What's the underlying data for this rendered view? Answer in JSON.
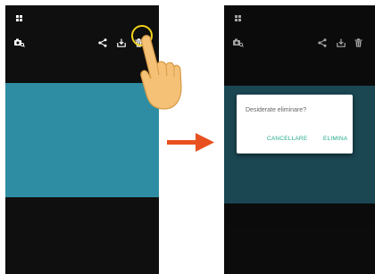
{
  "icons": {
    "grid": "grid-icon",
    "camera": "camera-search-icon",
    "share": "share-icon",
    "download": "download-icon",
    "delete": "trash-icon",
    "hand": "pointing-hand-icon",
    "arrow": "arrow-right-icon"
  },
  "colors": {
    "screen_bg": "#0f0f0f",
    "photo": "#2e8da3",
    "highlight": "#f2d21a",
    "arrow": "#e8501f",
    "dialog_button": "#21a98c"
  },
  "dialog": {
    "message": "Desiderate eliminare?",
    "cancel_label": "CANCELLARE",
    "delete_label": "ELIMINA"
  }
}
